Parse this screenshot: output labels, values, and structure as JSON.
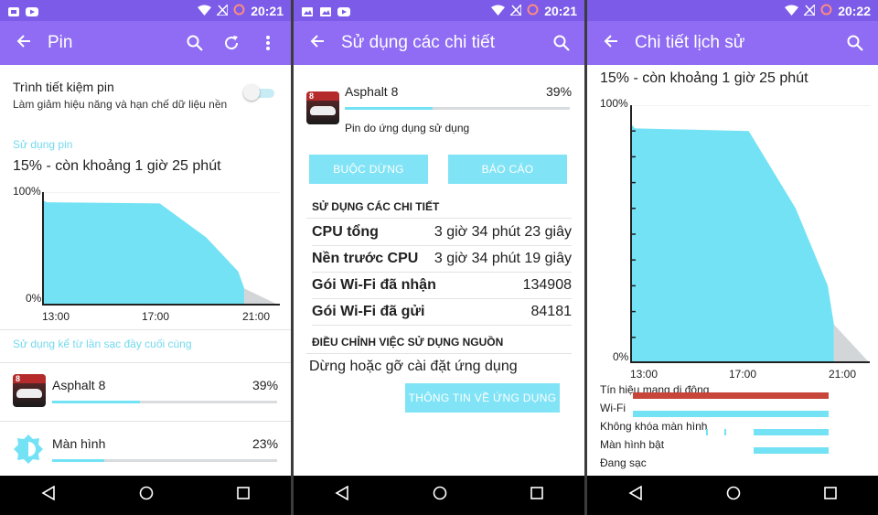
{
  "colors": {
    "statusbar": "#7b5be8",
    "toolbar": "#8f6cf3",
    "accent": "#74d9ee",
    "chart_fill": "#74e2f5",
    "chart_projection": "#d3d6d9",
    "mobile_signal": "#c8453a"
  },
  "status": {
    "p1_time": "20:21",
    "p2_time": "20:21",
    "p3_time": "20:22"
  },
  "panel1": {
    "title": "Pin",
    "icons": [
      "back-arrow-icon",
      "search-icon",
      "refresh-icon",
      "overflow-menu-icon"
    ],
    "saver_title": "Trình tiết kiệm pin",
    "saver_sub": "Làm giảm hiệu năng và hạn chế dữ liệu nền",
    "usage_header": "Sử dụng pin",
    "usage_status": "15% - còn khoảng 1 giờ 25 phút",
    "since_header": "Sử dụng kể từ lần sạc đầy cuối cùng",
    "apps": [
      {
        "name": "Asphalt 8",
        "pct_label": "39%",
        "pct": 0.39,
        "icon": "asphalt-8-icon"
      },
      {
        "name": "Màn hình",
        "pct_label": "23%",
        "pct": 0.23,
        "icon": "screen-brightness-icon"
      }
    ]
  },
  "panel2": {
    "title": "Sử dụng các chi tiết",
    "app_name": "Asphalt 8",
    "app_pct_label": "39%",
    "app_pct": 0.39,
    "app_sub": "Pin do ứng dụng sử dụng",
    "force_stop": "BUỘC DỪNG",
    "report": "BÁO CÁO",
    "details_header": "SỬ DỤNG CÁC CHI TIẾT",
    "details": [
      {
        "k": "CPU tổng",
        "v": "3 giờ 34 phút 23 giây"
      },
      {
        "k": "Nền trước CPU",
        "v": "3 giờ 34 phút 19 giây"
      },
      {
        "k": "Gói Wi-Fi đã nhận",
        "v": "134908"
      },
      {
        "k": "Gói Wi-Fi đã gửi",
        "v": "84181"
      }
    ],
    "adjust_header": "ĐIỀU CHỈNH VIỆC SỬ DỤNG NGUỒN",
    "adjust_text": "Dừng hoặc gỡ cài đặt ứng dụng",
    "app_info": "THÔNG TIN VỀ ỨNG DỤNG"
  },
  "panel3": {
    "title": "Chi tiết lịch sử",
    "usage_status": "15% - còn khoảng 1 giờ 25 phút",
    "legend": [
      "Tín hiệu mạng di động",
      "Wi-Fi",
      "Không khóa màn hình",
      "Màn hình bật",
      "Đang sạc"
    ]
  },
  "chart_data": [
    {
      "type": "area",
      "ylim": [
        0,
        100
      ],
      "y_tick_labels": [
        "100%",
        "0%"
      ],
      "x_tick_labels": [
        "13:00",
        "17:00",
        "21:00"
      ],
      "series": [
        {
          "x": [
            12.5,
            12.7,
            17.3,
            19.2,
            20.5,
            20.75
          ],
          "values": [
            93,
            91,
            90,
            60,
            30,
            15
          ]
        },
        {
          "x": [
            20.75,
            22.2
          ],
          "values": [
            15,
            0
          ]
        }
      ]
    },
    {
      "type": "area",
      "ylim": [
        0,
        100
      ],
      "y_tick_labels": [
        "100%",
        "0%"
      ],
      "x_tick_labels": [
        "13:00",
        "17:00",
        "21:00"
      ],
      "series": [
        {
          "x": [
            12.5,
            12.7,
            17.3,
            19.2,
            20.5,
            20.75
          ],
          "values": [
            93,
            91,
            90,
            60,
            30,
            15
          ]
        },
        {
          "x": [
            20.75,
            22.2
          ],
          "values": [
            15,
            0
          ]
        }
      ]
    }
  ]
}
